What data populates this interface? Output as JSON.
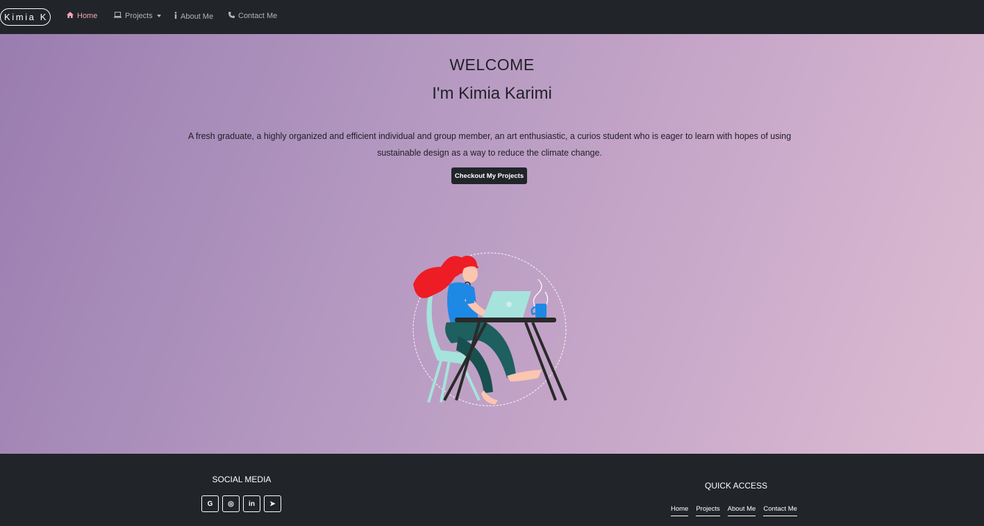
{
  "navbar": {
    "brand": "Kimia K",
    "items": [
      {
        "label": "Home",
        "icon": "home-icon",
        "active": true
      },
      {
        "label": "Projects",
        "icon": "laptop-icon",
        "dropdown": true
      },
      {
        "label": "About Me",
        "icon": "info-icon"
      },
      {
        "label": "Contact Me",
        "icon": "phone-icon"
      }
    ]
  },
  "hero": {
    "title": "WELCOME",
    "subtitle": "I'm Kimia Karimi",
    "description": "A fresh graduate, a highly organized and efficient individual and group member, an art enthusiastic, a curios student who is eager to learn with hopes of using sustainable design as a way to reduce the climate change.",
    "cta_label": "Checkout My Projects",
    "illustration": "woman-working-on-laptop-illustration"
  },
  "footer": {
    "social_title": "SOCIAL MEDIA",
    "social": [
      {
        "label": "G",
        "icon": "google-icon"
      },
      {
        "label": "◎",
        "icon": "instagram-icon"
      },
      {
        "label": "in",
        "icon": "linkedin-icon"
      },
      {
        "label": "➤",
        "icon": "telegram-icon"
      }
    ],
    "quick_title": "QUICK ACCESS",
    "quick_links": [
      "Home",
      "Projects",
      "About Me",
      "Contact Me"
    ]
  },
  "colors": {
    "dark": "#212529",
    "active_nav": "#f3a6b4",
    "gradient_start": "#9a7db0",
    "gradient_end": "#ddbcd2"
  }
}
